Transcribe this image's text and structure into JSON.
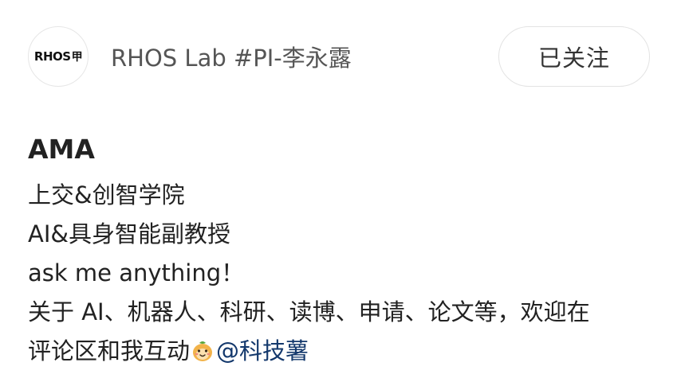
{
  "author": {
    "avatar_text": "RHOS",
    "avatar_glyph": "甲",
    "name": "RHOS Lab #PI-李永露"
  },
  "follow_button": {
    "label": "已关注"
  },
  "post": {
    "title": "AMA",
    "lines": [
      "上交&创智学院",
      "AI&具身智能副教授",
      "ask me anything！",
      "关于 AI、机器人、科研、读博、申请、论文等，欢迎在",
      "评论区和我互动"
    ],
    "emoji": "smiling-mascot-icon",
    "mention": "@科技薯"
  },
  "colors": {
    "background": "#ffffff",
    "text": "#222222",
    "name_text": "#555555",
    "mention": "#13386c",
    "border": "#e3e3e3"
  }
}
